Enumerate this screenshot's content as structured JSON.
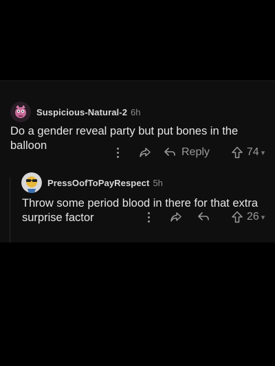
{
  "comment1": {
    "username": "Suspicious-Natural-2",
    "age": "6h",
    "body": "Do a gender reveal party but put bones in the balloon",
    "actions": {
      "reply_label": "Reply",
      "upvotes": "74"
    }
  },
  "comment2": {
    "username": "PressOofToPayRespect",
    "age": "5h",
    "body": "Throw some period blood in there for that extra surprise factor",
    "actions": {
      "upvotes": "26"
    }
  },
  "icons": {
    "more": "more-vertical-icon",
    "share": "share-arrow-icon",
    "reply": "reply-arrow-icon",
    "upvote": "upvote-arrow-icon"
  },
  "colors": {
    "background": "#000000",
    "panel": "#0f0f10",
    "username": "#d9d9d9",
    "muted": "#8c8c8c",
    "text": "#e6e6e6"
  }
}
